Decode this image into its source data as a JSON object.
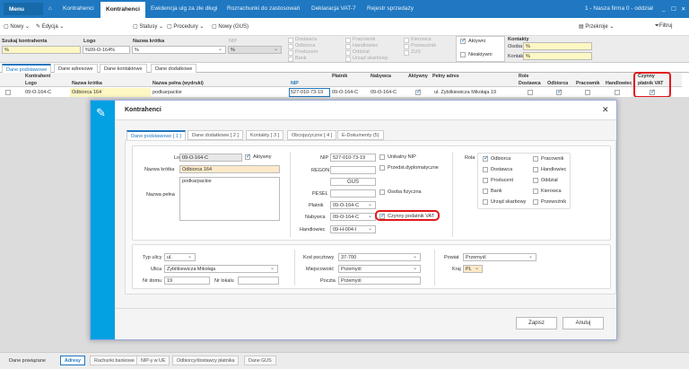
{
  "topbar": {
    "menu": "Menu",
    "tabs": [
      "Kontrahenci",
      "Kontrahenci",
      "Ewidencja ulg za złe długi",
      "Rozrachunki do zastosowań",
      "Deklaracja VAT-7",
      "Rejestr sprzedaży"
    ],
    "company": "1 - Nasza firma 0 - oddział"
  },
  "toolbar": {
    "new": "Nowy",
    "edit": "Edycja",
    "statuses": "Statusy",
    "procedures": "Procedury",
    "new_gus": "Nowy (GUS)",
    "views": "Przekroje",
    "filter": "Filtruj"
  },
  "filters": {
    "search_label": "Szukaj kontrahenta",
    "search_value": "%",
    "logo_label": "Logo",
    "logo_value": "%09-O-164%",
    "short_label": "Nazwa krótka",
    "short_value": "%",
    "nip_label": "NIP",
    "nip_value": "%",
    "roles1": [
      "Dostawca",
      "Odbiorca",
      "Producent",
      "Bank"
    ],
    "roles2": [
      "Pracownik",
      "Handlowiec",
      "Oddział",
      "Urząd skarbowy"
    ],
    "roles3": [
      "Kierowca",
      "Przewoźnik",
      "ZUS"
    ],
    "active": "Aktywni",
    "inactive": "Nieaktywni",
    "contacts": "Kontakty",
    "person": "Osoba",
    "person_value": "%",
    "contact": "Kontakt",
    "contact_value": "%"
  },
  "tabs": [
    "Dane podstawowe",
    "Dane adresowe",
    "Dane kontaktowe",
    "Dane dodatkowe"
  ],
  "grid": {
    "group_kontrahent": "Kontrahent",
    "logo": "Logo",
    "short": "Nazwa krótka",
    "full": "Nazwa pełna (wydruki)",
    "nip": "NIP",
    "payer": "Płatnik",
    "buyer": "Nabywca",
    "active": "Aktywny",
    "address": "Pełny adres",
    "role": "Role",
    "supplier": "Dostawca",
    "recipient": "Odbiorca",
    "employee": "Pracownik",
    "trader": "Handlowiec",
    "vat1": "Czynny",
    "vat2": "płatnik VAT",
    "row": {
      "logo": "09-O-164-C",
      "short": "Odbiorca 164",
      "full": "podkarpackie",
      "nip": "527-010-73-19",
      "payer": "09-O-164-C",
      "buyer": "09-O-164-C",
      "address": "ul. Zybilkiewicza Mikołaja 19"
    }
  },
  "modal": {
    "title": "Kontrahenci",
    "tabs": [
      "Dane podstawowe [ 1 ]",
      "Dane dodatkowe [ 2 ]",
      "Kontakty [ 3 ]",
      "Obcojęzyczne [ 4 ]",
      "E-Dokumenty (5)"
    ],
    "logo_label": "Logo",
    "logo": "09-O-164-C",
    "active": "Aktywny",
    "short_label": "Nazwa krótka",
    "short": "Odbiorca 164",
    "full_label": "Nazwa pełna",
    "full": "podkarpackie",
    "nip_label": "NIP",
    "nip": "527-010-73-19",
    "unique_nip": "Unikalny NIP",
    "regon_label": "REGON",
    "diplomatic": "Przedst.dyplomatyczne",
    "gus": "GUS",
    "pesel_label": "PESEL",
    "natural": "Osoba fizyczna",
    "payer_label": "Płatnik",
    "payer": "09-O-164-C",
    "buyer_label": "Nabywca",
    "buyer": "09-O-164-C",
    "vat": "Czynny podatnik VAT",
    "trader_label": "Handlowiec",
    "trader": "09-H-004-I",
    "role_label": "Rola",
    "roles_left": [
      "Odbiorca",
      "Dostawca",
      "Producent",
      "Bank",
      "Urząd skarbowy"
    ],
    "roles_right": [
      "Pracownik",
      "Handlowiec",
      "Oddział",
      "Kierowca",
      "Przewoźnik"
    ],
    "street_type_label": "Typ ulicy",
    "street_type": "ul.",
    "street_label": "Ulica",
    "street": "Zybilkiewicza Mikołaja",
    "house_label": "Nr domu",
    "house": "19",
    "flat_label": "Nr lokalu",
    "zip_label": "Kod pocztowy",
    "zip": "37-700",
    "city_label": "Miejscowość",
    "city": "Przemyśl",
    "post_label": "Poczta",
    "post": "Przemyśl",
    "county_label": "Powiat",
    "county": "Przemyśl",
    "country_label": "Kraj",
    "country": "PL",
    "save": "Zapisz",
    "cancel": "Anuluj"
  },
  "bottom": {
    "related": "Dane powiązane",
    "tabs": [
      "Adresy",
      "Rachunki bankowe",
      "NIP-y w UE",
      "Odbiorcy/dostawcy płatnika",
      "Dane GUS"
    ]
  }
}
